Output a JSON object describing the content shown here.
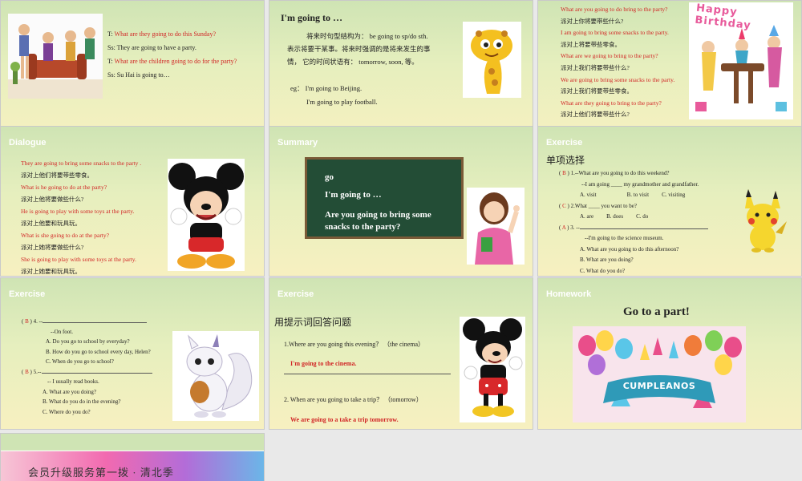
{
  "slide1": {
    "lines": [
      {
        "speaker": "T: ",
        "text": "What are they going to do this Sunday?",
        "red": true
      },
      {
        "speaker": "Ss: ",
        "text": "They are going to have a party.",
        "red": false
      },
      {
        "speaker": "T: ",
        "text": "What are the children going to do for the party?",
        "red": true
      },
      {
        "speaker": " Ss: ",
        "text": "Su Hai is going to…",
        "red": false
      }
    ]
  },
  "slide2": {
    "title": "I'm going to …",
    "lines": [
      "将来时句型结构为： be going to sp/do sth.",
      "表示将要干某事。将来时强调的是将来发生的事",
      "情，  它的时间状语有： tomorrow, soon, 等。"
    ],
    "eg_label": "eg：",
    "eg1": "I'm going to Beijing.",
    "eg2": "I'm going to play football."
  },
  "slide3": {
    "lines": [
      {
        "text": "What are you going to do bring to the party?",
        "red": true
      },
      {
        "text": "派对上你将要带些什么?",
        "red": false
      },
      {
        "text": "I am going to bring some snacks to the party.",
        "red": true
      },
      {
        "text": "派对上将要带些零食。",
        "red": false
      },
      {
        "text": "What are we going to bring to the party?",
        "red": true
      },
      {
        "text": " 派对上我们将要带些什么?",
        "red": false
      },
      {
        "text": "We are going to bring some snacks to the party.",
        "red": true
      },
      {
        "text": "派对上我们将要带些零食。",
        "red": false
      },
      {
        "text": "What are they going to bring to the party?",
        "red": true
      },
      {
        "text": "派对上他们将要带些什么?",
        "red": false
      }
    ],
    "banner": "Happy Birthday"
  },
  "slide4": {
    "heading": "Dialogue",
    "lines": [
      {
        "text": "They are going to bring some snacks to the party .",
        "red": true
      },
      {
        "text": "派对上他们将要带些零食。",
        "red": false
      },
      {
        "text": "What is he going to do at the party?",
        "red": true
      },
      {
        "text": " 派对上他将要做些什么?",
        "red": false
      },
      {
        "text": "He is going to play with some toys at the party.",
        "red": true
      },
      {
        "text": "派对上他要和玩具玩。",
        "red": false
      },
      {
        "text": "What is she going to do at the party?",
        "red": true
      },
      {
        "text": "派对上她将要做些什么?",
        "red": false
      },
      {
        "text": "She is going to play with some toys at the party.",
        "red": true
      },
      {
        "text": "派对上她要和玩具玩。",
        "red": false
      }
    ]
  },
  "slide5": {
    "heading": "Summary",
    "board1": "go",
    "board2": "I'm going to …",
    "board3": "Are you going to bring some",
    "board4": "snacks to the party?"
  },
  "slide6": {
    "heading": "Exercise",
    "title": "单项选择",
    "q1": {
      "ans": "B",
      "stem": ") 1.--What are you going to do this weekend?",
      "line2": "--I am going ____ my grandmother and grandfather.",
      "a": "A. visit",
      "b": "B. to visit",
      "c": "C. visiting"
    },
    "q2": {
      "ans": "C",
      "stem": ") 2.What ____ you want to be?",
      "a": "A. are",
      "b": "B. does",
      "c": "C. do"
    },
    "q3": {
      "ans": "A",
      "stem": ") 3. --",
      "line2": "--I'm going to the science museum.",
      "a": "A. What are you going to do this afternoon?",
      "b": "B. What are you doing?",
      "c": "C. What do you do?"
    }
  },
  "slide7": {
    "heading": "Exercise",
    "q4": {
      "ans": "B",
      "stem": ") 4. --",
      "line2": "--On foot.",
      "a": "A. Do you go to school by everyday?",
      "b": "B.  How do you go to school every day, Helen?",
      "c": "C. When do you go to school?"
    },
    "q5": {
      "ans": "B",
      "stem": ") 5.--",
      "line2": "-- I usually read books.",
      "a": "A. What are you doing?",
      "b": "B. What do you do in the evening?",
      "c": "C. Where do you do?"
    }
  },
  "slide8": {
    "heading": "Exercise",
    "title": "用提示词回答问题",
    "q1": "1.Where are you going this evening？ （the cinema）",
    "a1": "I'm going to the cinema.",
    "q2": "2. When are you going to take a trip？ （tomorrow）",
    "a2": "We are going to a take a trip tomorrow."
  },
  "slide9": {
    "heading": "Homework",
    "title": "Go to a part!",
    "banner": "CUMPLEANOS"
  },
  "slide10": {
    "text": "会员升级服务第一拨 · 清北季"
  }
}
